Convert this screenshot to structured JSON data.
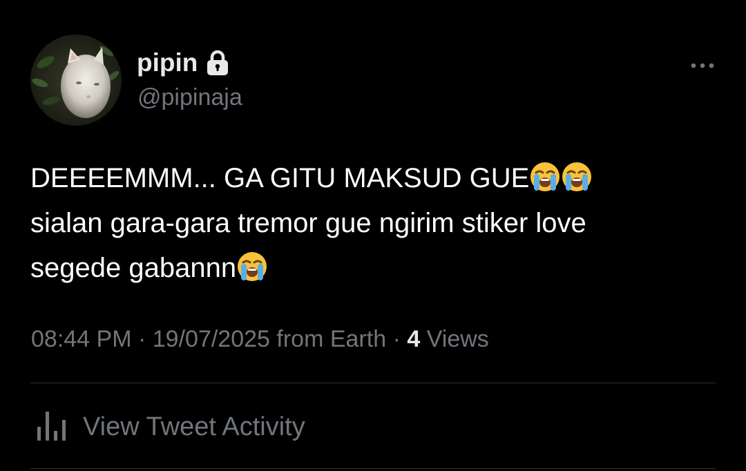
{
  "user": {
    "display_name": "pipin",
    "handle": "@pipinaja",
    "protected_icon": "lock-icon",
    "avatar_description_icon": "cat-avatar"
  },
  "tweet": {
    "lines": [
      "DEEEEMMM... GA GITU MAKSUD GUE",
      "sialan gara-gara tremor gue ngirim stiker love",
      "segede gabannn"
    ],
    "emoji_name": "loudly-crying-face-emoji"
  },
  "meta": {
    "time": "08:44 PM",
    "separator": "·",
    "date": "19/07/2025",
    "source": "from Earth",
    "views_count": "4",
    "views_label": "Views"
  },
  "activity": {
    "label": "View Tweet Activity",
    "icon": "bar-chart-icon"
  },
  "colors": {
    "background": "#000000",
    "primary_text": "#e7e9ea",
    "secondary_text": "#71767b",
    "divider": "#2f3336"
  }
}
